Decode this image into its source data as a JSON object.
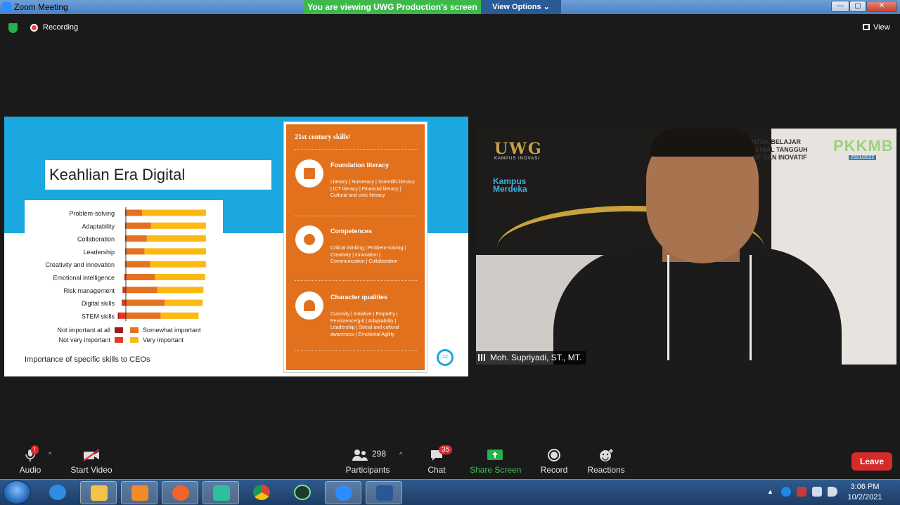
{
  "window": {
    "title": "Zoom Meeting",
    "share_banner": "You are viewing UWG Production's screen",
    "view_options": "View Options",
    "minimize": "—",
    "maximize": "▢",
    "close": "✕"
  },
  "top": {
    "recording_label": "Recording",
    "view_label": "View"
  },
  "slide": {
    "title": "Keahlian Era Digital",
    "caption": "Importance of specific skills to CEOs",
    "page_number": "12",
    "panel": {
      "heading": "21st century skills¹",
      "sections": [
        {
          "title": "Foundation literacy",
          "body": "Literacy | Numeracy | Scientific literacy | ICT literacy | Financial literacy | Cultural and civic literacy"
        },
        {
          "title": "Competences",
          "body": "Critical thinking | Problem-solving | Creativity | Innovation | Communication | Collaboration"
        },
        {
          "title": "Character qualities",
          "body": "Curiosity | Initiative | Empathy | Persistence/grit | Adaptability | Leadership | Social and cultural awareness | Emotional Agility"
        }
      ]
    }
  },
  "chart_data": {
    "type": "bar",
    "stacked": true,
    "categories": [
      "Problem-solving",
      "Adaptability",
      "Collaboration",
      "Leadership",
      "Creativity and innovation",
      "Emotional intelligence",
      "Risk management",
      "Digital skills",
      "STEM skills"
    ],
    "series": [
      {
        "name": "Not important at all",
        "color": "#9a1b1b",
        "values": [
          0,
          0,
          0,
          0,
          0,
          0,
          1,
          1,
          2
        ]
      },
      {
        "name": "Not very important",
        "color": "#e03a24",
        "values": [
          1,
          1,
          1,
          1,
          1,
          2,
          3,
          4,
          8
        ]
      },
      {
        "name": "Somewhat important",
        "color": "#e37222",
        "values": [
          20,
          31,
          26,
          23,
          30,
          36,
          39,
          48,
          43
        ]
      },
      {
        "name": "Very important",
        "color": "#fdb913",
        "values": [
          79,
          68,
          73,
          76,
          69,
          62,
          57,
          47,
          47
        ]
      }
    ],
    "legend": [
      [
        "Not important at all",
        "Somewhat important"
      ],
      [
        "Not very important",
        "Very important"
      ]
    ]
  },
  "video": {
    "participant_name": "Moh. Supriyadi, ST., MT.",
    "background": {
      "logo": "UWG",
      "logo_sub": "KAMPUS INOVASI",
      "kampus": [
        "Kampus",
        "Merdeka"
      ],
      "banner": [
        "NTUK BELAJAR",
        "LENIAL TANGGUH",
        "TIF DAN INOVATIF"
      ],
      "pkkmb": "PKKMB",
      "year": "2021/2022"
    }
  },
  "toolbar": {
    "audio": "Audio",
    "start_video": "Start Video",
    "participants": "Participants",
    "participants_count": "298",
    "chat": "Chat",
    "chat_badge": "35",
    "share_screen": "Share Screen",
    "record": "Record",
    "reactions": "Reactions",
    "leave": "Leave"
  },
  "taskbar": {
    "time": "3:06 PM",
    "date": "10/2/2021",
    "apps": [
      "internet-explorer",
      "file-explorer",
      "media-player",
      "firefox",
      "filmora",
      "chrome",
      "vectr",
      "zoom",
      "word"
    ]
  }
}
